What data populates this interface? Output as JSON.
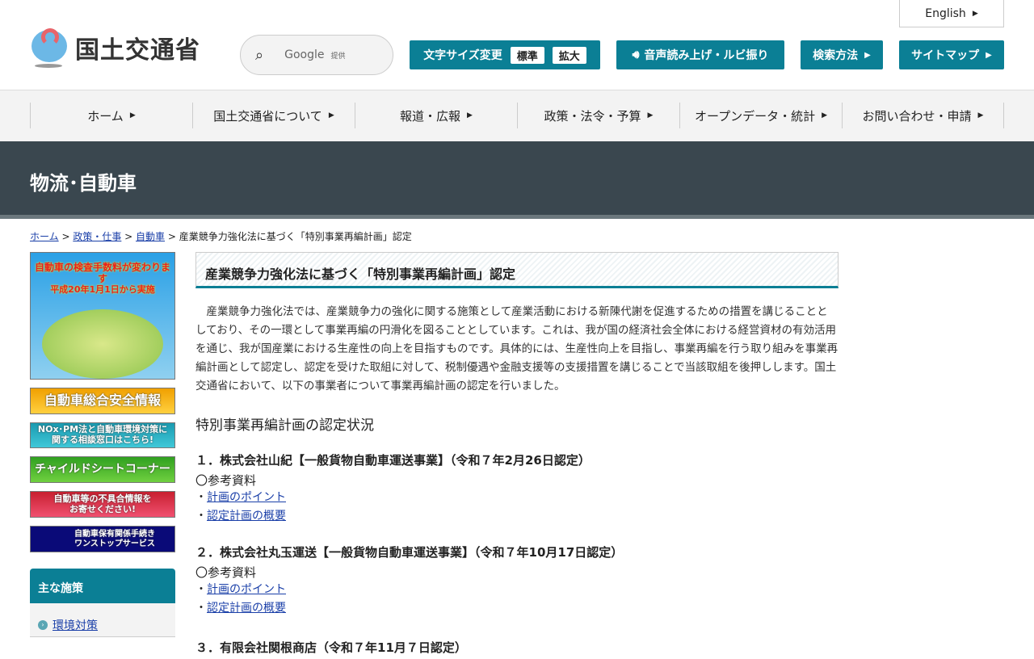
{
  "header": {
    "logo_text": "国土交通省",
    "search_label": "Google",
    "search_provided": "提供",
    "font_size_label": "文字サイズ変更",
    "font_standard": "標準",
    "font_large": "拡大",
    "voice_label": "音声読み上げ・ルビ振り",
    "search_method": "検索方法",
    "sitemap": "サイトマップ",
    "english": "English"
  },
  "nav": [
    "ホーム",
    "国土交通省について",
    "報道・広報",
    "政策・法令・予算",
    "オープンデータ・統計",
    "お問い合わせ・申請"
  ],
  "banner": "物流･自動車",
  "breadcrumb": {
    "items": [
      "ホーム",
      "政策・仕事",
      "自動車"
    ],
    "current": "産業競争力強化法に基づく「特別事業再編計画」認定"
  },
  "sidebar": {
    "banners": [
      {
        "line1": "自動車の検査手数料が変わります",
        "line2": "平成20年1月1日から実施"
      },
      {
        "line1": "自動車総合安全情報"
      },
      {
        "line1": "NOx･PM法と自動車環境対策に",
        "line2": "関する相談窓口はこちら!"
      },
      {
        "line1": "チャイルドシートコーナー"
      },
      {
        "line1": "自動車等の不具合情報を",
        "line2": "お寄せください!"
      },
      {
        "line1": "自動車保有関係手続き",
        "line2": "ワンストップサービス"
      }
    ],
    "section_title": "主な施策",
    "items": [
      "環境対策"
    ]
  },
  "main": {
    "title": "産業競争力強化法に基づく「特別事業再編計画」認定",
    "intro": "　産業競争力強化法では、産業競争力の強化に関する施策として産業活動における新陳代謝を促進するための措置を講じることとしており、その一環として事業再編の円滑化を図ることとしています。これは、我が国の経済社会全体における経営資材の有効活用を通じ、我が国産業における生産性の向上を目指すものです。具体的には、生産性向上を目指し、事業再編を行う取り組みを事業再編計画として認定し、認定を受けた取組に対して、税制優遇や金融支援等の支援措置を講じることで当該取組を後押しします。国土交通省において、以下の事業者について事業再編計画の認定を行いました。",
    "subtitle": "特別事業再編計画の認定状況",
    "items": [
      {
        "heading": "１．株式会社山紀【一般貨物自動車運送事業】（令和７年2月26日認定）",
        "ref": "〇参考資料",
        "links": [
          "計画のポイント",
          "認定計画の概要"
        ]
      },
      {
        "heading": "２．株式会社丸玉運送【一般貨物自動車運送事業】（令和７年10月17日認定）",
        "ref": "〇参考資料",
        "links": [
          "計画のポイント",
          "認定計画の概要"
        ]
      },
      {
        "heading": "３．有限会社関根商店（令和７年11月７日認定）"
      }
    ]
  }
}
